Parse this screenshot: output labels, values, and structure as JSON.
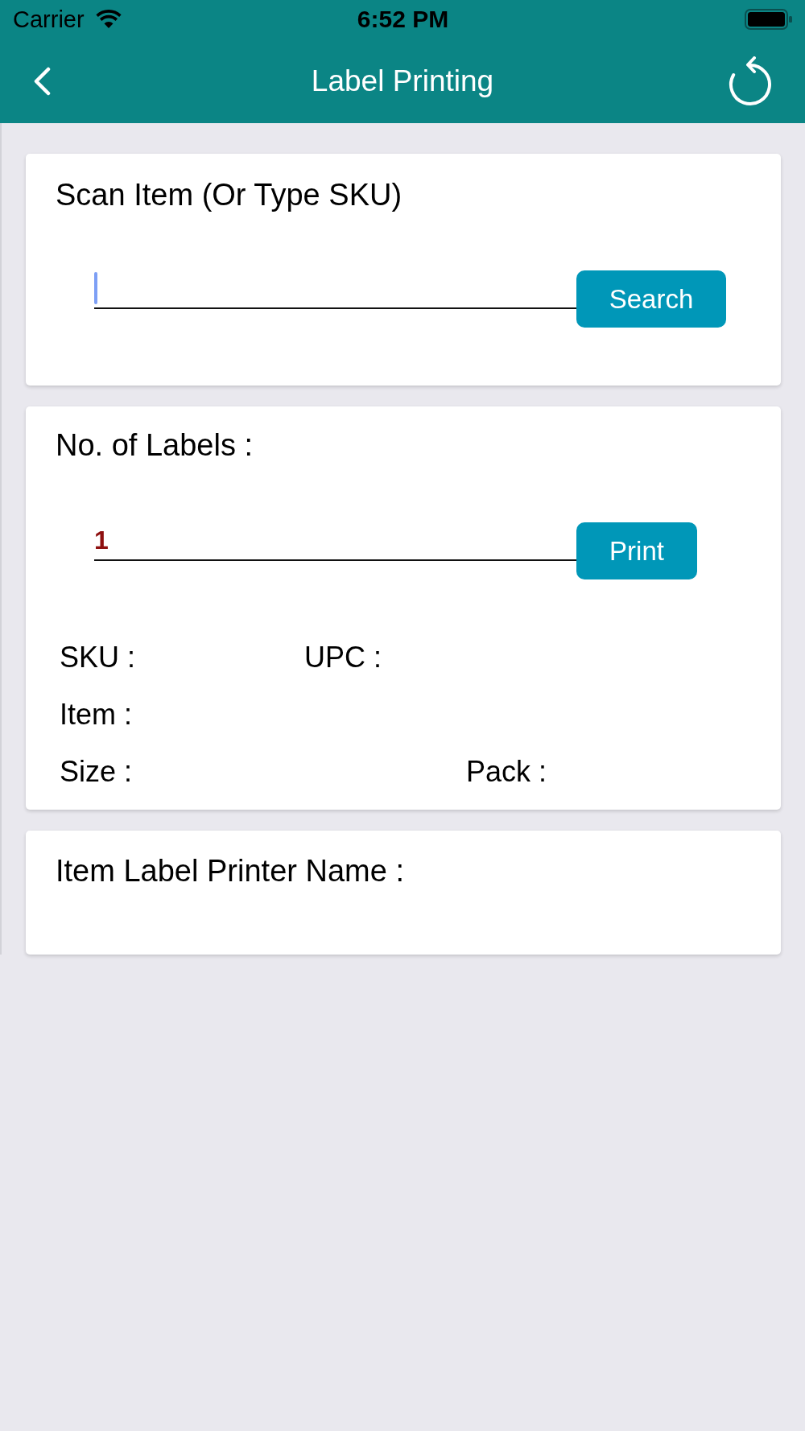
{
  "status_bar": {
    "carrier": "Carrier",
    "time": "6:52 PM"
  },
  "header": {
    "title": "Label Printing"
  },
  "scan_card": {
    "title": "Scan Item (Or Type SKU)",
    "input": {
      "focused": true
    },
    "button": "Search"
  },
  "labels_card": {
    "title": "No. of Labels :",
    "input": {
      "value": "1",
      "focused": false
    },
    "button": "Print",
    "rows": [
      [
        "SKU :",
        "UPC :"
      ],
      [
        "Item :"
      ],
      [
        "Size :",
        "Pack :"
      ]
    ]
  },
  "printer_card": {
    "title": "Item Label Printer Name :"
  }
}
